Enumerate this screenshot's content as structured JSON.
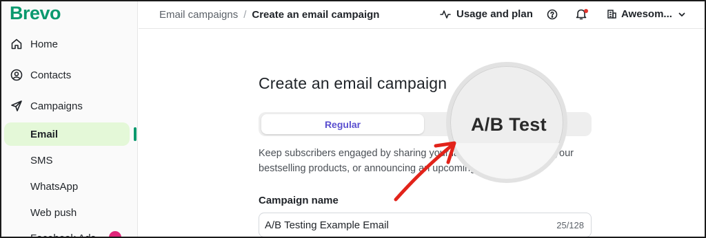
{
  "app": {
    "logo": "Brevo",
    "brand_color": "#0b996e"
  },
  "sidebar": {
    "items": [
      {
        "label": "Home",
        "icon": "home-icon"
      },
      {
        "label": "Contacts",
        "icon": "contacts-icon"
      },
      {
        "label": "Campaigns",
        "icon": "send-icon"
      }
    ],
    "sub_items": [
      {
        "label": "Email",
        "active": true
      },
      {
        "label": "SMS"
      },
      {
        "label": "WhatsApp"
      },
      {
        "label": "Web push"
      },
      {
        "label": "Facebook Ads"
      }
    ]
  },
  "header": {
    "breadcrumb_parent": "Email campaigns",
    "breadcrumb_separator": "/",
    "breadcrumb_current": "Create an email campaign",
    "usage_label": "Usage and plan",
    "account_label": "Awesom...",
    "notification_dot_color": "#e2342d"
  },
  "main": {
    "title": "Create an email campaign",
    "tabs": [
      {
        "label": "Regular",
        "selected": true
      },
      {
        "label": "A/B Test",
        "selected": false
      }
    ],
    "description": "Keep subscribers engaged by sharing your latest news, promoting your bestselling products, or announcing an upcoming event.",
    "campaign_name_label": "Campaign name",
    "campaign_name_value": "A/B Testing Example Email",
    "campaign_name_counter": "25/128"
  },
  "colors": {
    "accent": "#5a4fcf",
    "active_bg": "#e4f8d8",
    "arrow": "#e2231a"
  }
}
